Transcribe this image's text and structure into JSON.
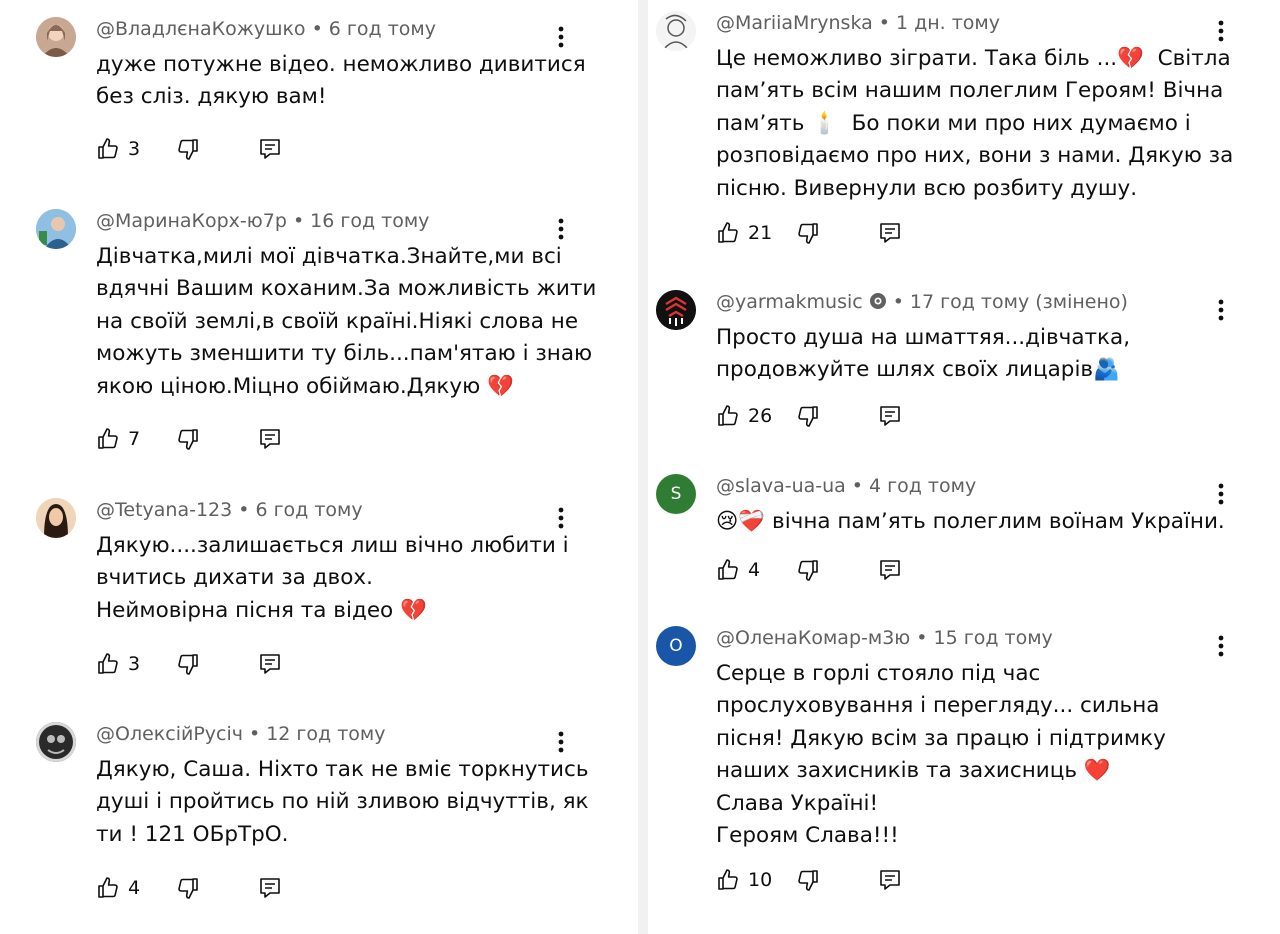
{
  "left_comments": [
    {
      "author": "@ВладлєнаКожушко",
      "time": "6 год тому",
      "text": "дуже потужне відео. неможливо дивитися без сліз. дякую вам!",
      "likes": "3"
    },
    {
      "author": "@МаринаКорх-ю7р",
      "time": "16 год тому",
      "text": "Дівчатка,милі мої дівчатка.Знайте,ми всі вдячні Вашим коханим.За можливість жити на своїй землі,в своїй країні.Ніякі слова не можуть зменшити ту біль...пам'ятаю і знаю якою ціною.Міцно обіймаю.Дякую 💔",
      "likes": "7"
    },
    {
      "author": "@Tetyana-123",
      "time": "6 год тому",
      "text": "Дякую....залишається лиш вічно любити і\nвчитись дихати за двох.\nНеймовірна пісня та відео 💔",
      "likes": "3"
    },
    {
      "author": "@ОлексійРусіч",
      "time": "12 год тому",
      "text": "Дякую, Саша. Ніхто так не вміє торкнутись душі і пройтись по ній зливою відчуттів, як ти ! 121 ОБрТрО.",
      "likes": "4"
    }
  ],
  "right_comments": [
    {
      "author": "@MariiaMrynska",
      "time": "1 дн. тому",
      "text": "Це неможливо зіграти. Така біль ...💔  Світла пам’ять всім нашим полеглим Героям! Вічна пам’ять 🕯️  Бо поки ми про них думаємо і розповідаємо про них, вони з нами. Дякую за пісню. Вивернули всю розбиту душу.",
      "likes": "21"
    },
    {
      "author": "@yarmakmusic",
      "time": "17 год тому (змінено)",
      "text": "Просто душа на шматтяя...дівчатка, продовжуйте шлях своїх лицарів🫂",
      "likes": "26"
    },
    {
      "author": "@slava-ua-ua",
      "time": "4 год тому",
      "text": "😢❤️‍🩹 вічна пам’ять полеглим воїнам України.",
      "likes": "4",
      "avatar_letter": "S"
    },
    {
      "author": "@ОленаКомар-м3ю",
      "time": "15 год тому",
      "text": "Серце в горлі стояло під час прослуховування і перегляду... сильна пісня! Дякую всім за працю і підтримку наших захисників та захисниць ❤️\nСлава Україні!\nГероям Слава!!!",
      "likes": "10",
      "avatar_letter": "O"
    }
  ],
  "colors": {
    "text": "#0f0f0f",
    "meta": "#606060",
    "avatar_s": "#2e7d32",
    "avatar_o": "#1a56a8"
  },
  "icons": [
    "like-icon",
    "dislike-icon",
    "reply-icon",
    "more-icon",
    "verified-icon"
  ]
}
